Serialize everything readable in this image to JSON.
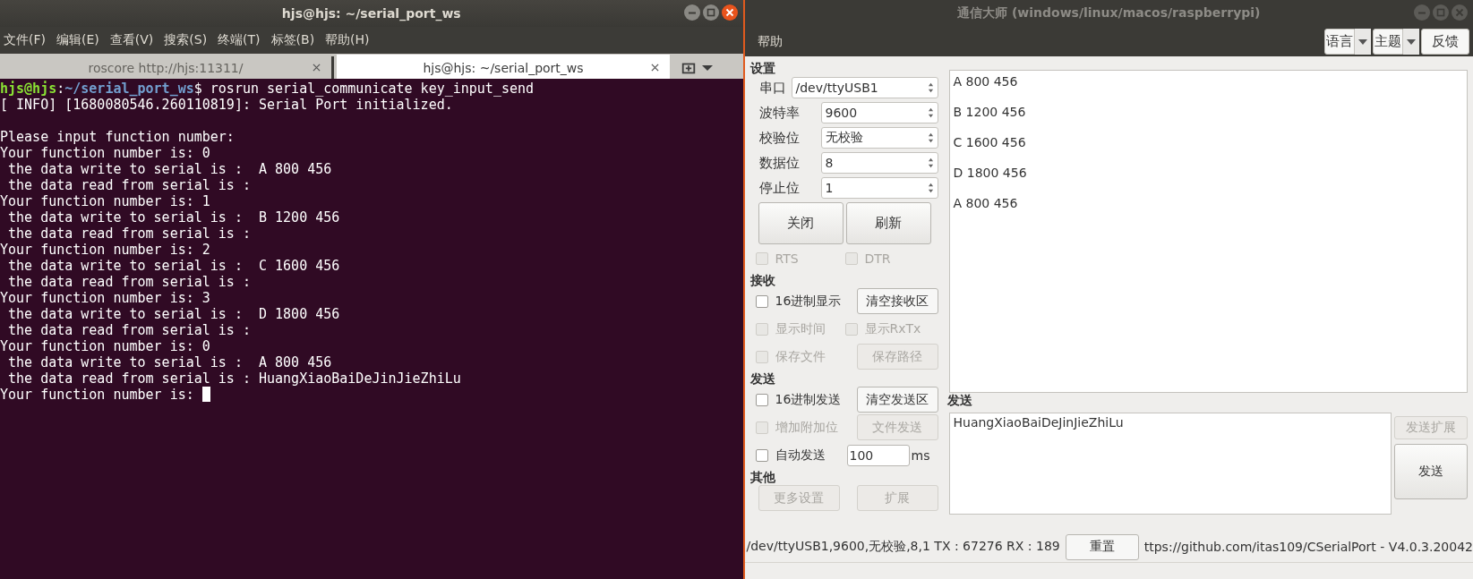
{
  "terminal": {
    "title": "hjs@hjs: ~/serial_port_ws",
    "menu": [
      "文件(F)",
      "编辑(E)",
      "查看(V)",
      "搜索(S)",
      "终端(T)",
      "标签(B)",
      "帮助(H)"
    ],
    "tabs": [
      {
        "label": "roscore http://hjs:11311/",
        "selected": false
      },
      {
        "label": "hjs@hjs: ~/serial_port_ws",
        "selected": true
      }
    ],
    "lines": [
      {
        "kind": "prompt",
        "user": "hjs@hjs",
        "separator": ":",
        "path": "~/serial_port_ws",
        "command": "$ rosrun serial_communicate key_input_send"
      },
      {
        "kind": "text",
        "text": "[ INFO] [1680080546.260110819]: Serial Port initialized."
      },
      {
        "kind": "blank"
      },
      {
        "kind": "text",
        "text": "Please input function number:"
      },
      {
        "kind": "text",
        "text": "Your function number is: 0"
      },
      {
        "kind": "text",
        "text": " the data write to serial is :  A 800 456"
      },
      {
        "kind": "text",
        "text": " the data read from serial is :"
      },
      {
        "kind": "text",
        "text": "Your function number is: 1"
      },
      {
        "kind": "text",
        "text": " the data write to serial is :  B 1200 456"
      },
      {
        "kind": "text",
        "text": " the data read from serial is :"
      },
      {
        "kind": "text",
        "text": "Your function number is: 2"
      },
      {
        "kind": "text",
        "text": " the data write to serial is :  C 1600 456"
      },
      {
        "kind": "text",
        "text": " the data read from serial is :"
      },
      {
        "kind": "text",
        "text": "Your function number is: 3"
      },
      {
        "kind": "text",
        "text": " the data write to serial is :  D 1800 456"
      },
      {
        "kind": "text",
        "text": " the data read from serial is :"
      },
      {
        "kind": "text",
        "text": "Your function number is: 0"
      },
      {
        "kind": "text",
        "text": " the data write to serial is :  A 800 456"
      },
      {
        "kind": "text",
        "text": " the data read from serial is : HuangXiaoBaiDeJinJieZhiLu"
      },
      {
        "kind": "cursor",
        "text": "Your function number is: "
      }
    ]
  },
  "app": {
    "title": "通信大师 (windows/linux/macos/raspberrypi)",
    "menu": [
      "帮助"
    ],
    "toolbar": [
      {
        "kind": "dropdown",
        "label": "语言"
      },
      {
        "kind": "dropdown",
        "label": "主题"
      },
      {
        "kind": "button",
        "label": "反馈"
      }
    ],
    "settings": {
      "heading": "设置",
      "fields": [
        {
          "label": "串口",
          "value": "/dev/ttyUSB1"
        },
        {
          "label": "波特率",
          "value": "9600"
        },
        {
          "label": "校验位",
          "value": "无校验"
        },
        {
          "label": "数据位",
          "value": "8"
        },
        {
          "label": "停止位",
          "value": "1"
        }
      ],
      "buttons": [
        "关闭",
        "刷新"
      ],
      "checks": [
        {
          "label": "RTS",
          "checked": false,
          "disabled": true
        },
        {
          "label": "DTR",
          "checked": false,
          "disabled": true
        }
      ]
    },
    "sections": [
      {
        "heading": "接收",
        "rows": [
          [
            {
              "kind": "check",
              "label": "16进制显示",
              "checked": false,
              "disabled": false
            },
            {
              "kind": "button",
              "label": "清空接收区",
              "disabled": false
            }
          ],
          [
            {
              "kind": "check",
              "label": "显示时间",
              "checked": false,
              "disabled": true
            },
            {
              "kind": "check",
              "label": "显示RxTx",
              "checked": false,
              "disabled": true
            }
          ],
          [
            {
              "kind": "check",
              "label": "保存文件",
              "checked": false,
              "disabled": true
            },
            {
              "kind": "button",
              "label": "保存路径",
              "disabled": true
            }
          ]
        ]
      },
      {
        "heading": "发送",
        "rows": [
          [
            {
              "kind": "check",
              "label": "16进制发送",
              "checked": false,
              "disabled": false
            },
            {
              "kind": "button",
              "label": "清空发送区",
              "disabled": false
            }
          ],
          [
            {
              "kind": "check",
              "label": "增加附加位",
              "checked": false,
              "disabled": true
            },
            {
              "kind": "button",
              "label": "文件发送",
              "disabled": true
            }
          ],
          [
            {
              "kind": "check",
              "label": "自动发送",
              "checked": false,
              "disabled": false
            },
            {
              "kind": "input",
              "value": "100"
            },
            {
              "kind": "unit",
              "label": "ms"
            }
          ]
        ]
      },
      {
        "heading": "其他",
        "rows": [
          [
            {
              "kind": "button",
              "label": "更多设置",
              "disabled": true
            },
            {
              "kind": "button",
              "label": "扩展",
              "disabled": true
            }
          ]
        ]
      }
    ],
    "receive_lines": [
      "A 800 456",
      "B 1200 456",
      "C 1600 456",
      "D 1800 456",
      "A 800 456"
    ],
    "send_heading": "发送",
    "send_value": "HuangXiaoBaiDeJinJieZhiLu",
    "send_buttons": [
      {
        "label": "发送扩展",
        "disabled": true
      },
      {
        "label": "发送",
        "disabled": false
      }
    ],
    "status": {
      "text": "/dev/ttyUSB1,9600,无校验,8,1 TX : 67276 RX : 189",
      "button": "重置",
      "link": "ttps://github.com/itas109/CSerialPort - V4.0.3.20042"
    }
  }
}
